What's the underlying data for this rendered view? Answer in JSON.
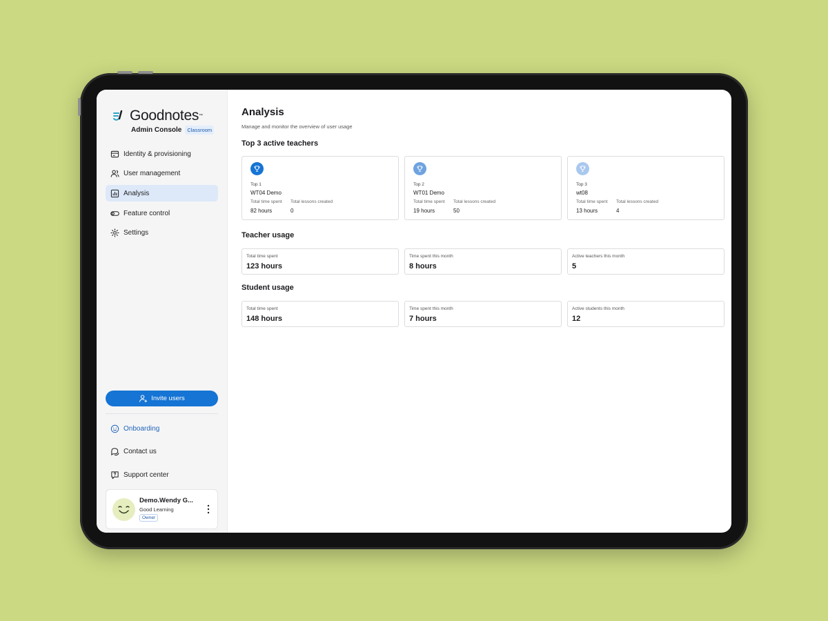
{
  "brand": {
    "name": "Goodnotes",
    "trademark": "™",
    "console": "Admin Console",
    "tag": "Classroom"
  },
  "sidebar": {
    "items": [
      {
        "label": "Identity & provisioning",
        "icon": "id-card-icon"
      },
      {
        "label": "User management",
        "icon": "users-icon"
      },
      {
        "label": "Analysis",
        "icon": "chart-icon",
        "active": true
      },
      {
        "label": "Feature control",
        "icon": "toggle-icon"
      },
      {
        "label": "Settings",
        "icon": "gear-icon"
      }
    ],
    "invite_label": "Invite users",
    "help": [
      {
        "label": "Onboarding",
        "icon": "smiley-icon"
      },
      {
        "label": "Contact us",
        "icon": "chat-icon"
      },
      {
        "label": "Support center",
        "icon": "help-bubble-icon"
      }
    ],
    "user": {
      "name": "Demo.Wendy G...",
      "org": "Good Learning",
      "role": "Owner"
    }
  },
  "main": {
    "title": "Analysis",
    "subtitle": "Manage and monitor the overview of user usage",
    "top_teachers": {
      "title": "Top 3 active teachers",
      "time_label": "Total time spent",
      "lessons_label": "Total lessons created",
      "cards": [
        {
          "rank": "Top 1",
          "name": "WT04 Demo",
          "time": "82 hours",
          "lessons": "0",
          "color": "#1574d4"
        },
        {
          "rank": "Top 2",
          "name": "WT01 Demo",
          "time": "19 hours",
          "lessons": "50",
          "color": "#6fa3e0"
        },
        {
          "rank": "Top 3",
          "name": "wt08",
          "time": "13 hours",
          "lessons": "4",
          "color": "#a9c8ee"
        }
      ]
    },
    "teacher_usage": {
      "title": "Teacher usage",
      "stats": [
        {
          "label": "Total time spent",
          "value": "123 hours"
        },
        {
          "label": "Time spent this month",
          "value": "8 hours"
        },
        {
          "label": "Active teachers this month",
          "value": "5"
        }
      ]
    },
    "student_usage": {
      "title": "Student usage",
      "stats": [
        {
          "label": "Total time spent",
          "value": "148 hours"
        },
        {
          "label": "Time spent this month",
          "value": "7 hours"
        },
        {
          "label": "Active students this month",
          "value": "12"
        }
      ]
    }
  },
  "colors": {
    "accent": "#1574d4",
    "active_nav": "#dde9f9",
    "background": "#cbd982"
  }
}
